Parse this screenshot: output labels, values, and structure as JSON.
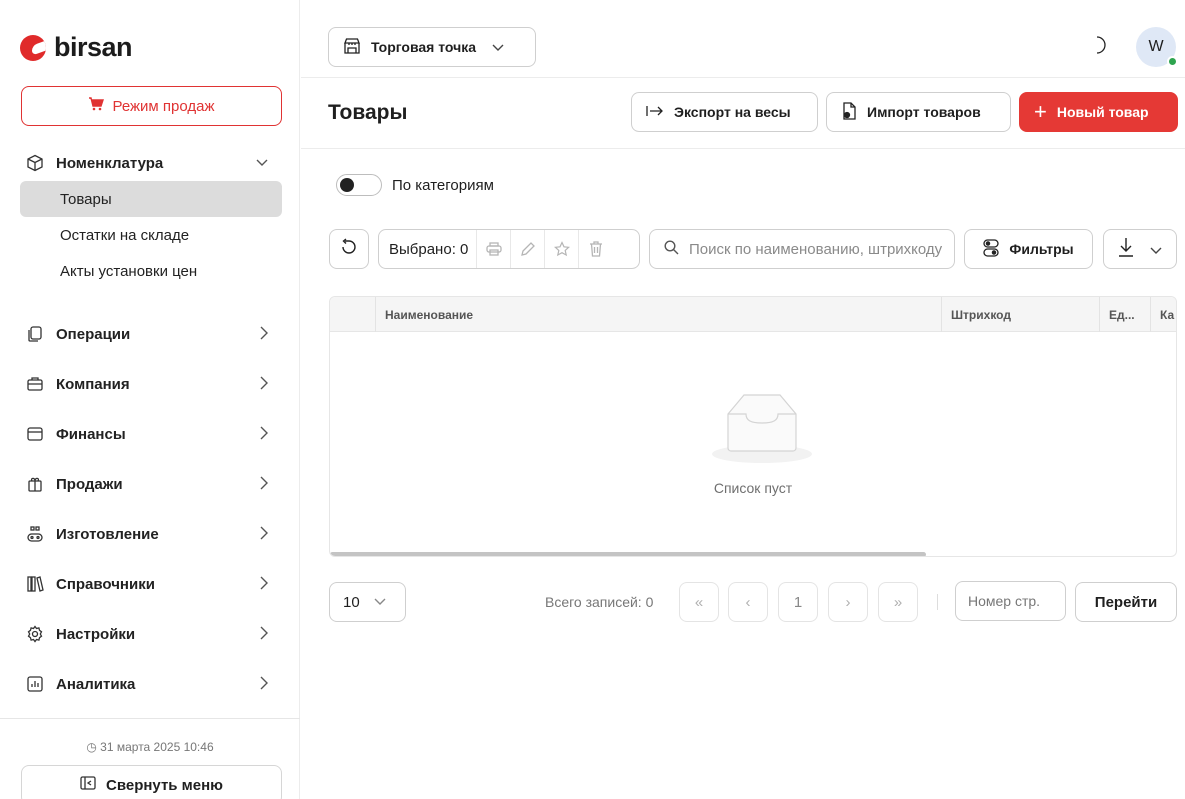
{
  "brand": {
    "name": "birsan",
    "accent": "#e53935"
  },
  "sidebar": {
    "sales_mode": "Режим продаж",
    "groups": [
      {
        "label": "Номенклатура",
        "icon": "box-icon",
        "expanded": true,
        "items": [
          {
            "label": "Товары",
            "active": true
          },
          {
            "label": "Остатки на складе"
          },
          {
            "label": "Акты установки цен"
          }
        ]
      },
      {
        "label": "Операции",
        "icon": "copy-icon"
      },
      {
        "label": "Компания",
        "icon": "briefcase-icon"
      },
      {
        "label": "Финансы",
        "icon": "wallet-icon"
      },
      {
        "label": "Продажи",
        "icon": "gift-icon"
      },
      {
        "label": "Изготовление",
        "icon": "factory-icon"
      },
      {
        "label": "Справочники",
        "icon": "books-icon"
      },
      {
        "label": "Настройки",
        "icon": "gear-icon"
      },
      {
        "label": "Аналитика",
        "icon": "chart-icon"
      }
    ],
    "datetime": "31 марта 2025 10:46",
    "collapse": "Свернуть меню"
  },
  "topbar": {
    "store": "Торговая точка",
    "avatar": "W"
  },
  "page": {
    "title": "Товары",
    "export": "Экспорт на весы",
    "import": "Импорт товаров",
    "new": "Новый товар",
    "by_category": "По категориям"
  },
  "toolbar": {
    "selected": "Выбрано: 0",
    "search_placeholder": "Поиск по наименованию, штрихкоду",
    "filters": "Фильтры"
  },
  "table": {
    "columns": [
      "",
      "Наименование",
      "Штрихкод",
      "Ед...",
      "Ка"
    ],
    "empty": "Список пуст"
  },
  "pagination": {
    "page_size": "10",
    "total": "Всего записей: 0",
    "current": "1",
    "page_placeholder": "Номер стр.",
    "go": "Перейти"
  }
}
